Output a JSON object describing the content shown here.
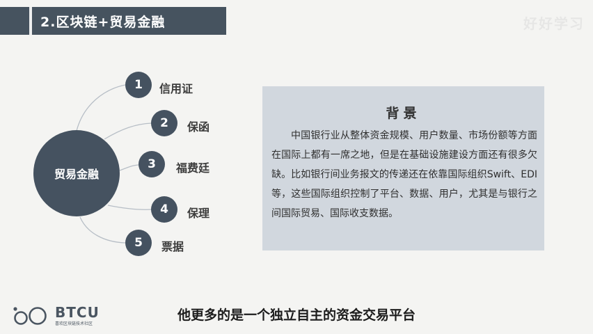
{
  "header": {
    "title": "2.区块链+贸易金融"
  },
  "watermark": {
    "text": "好好学习"
  },
  "diagram": {
    "center": {
      "label": "贸易金融"
    },
    "items": [
      {
        "number": "1",
        "label": "信用证"
      },
      {
        "number": "2",
        "label": "保函"
      },
      {
        "number": "3",
        "label": "福费廷"
      },
      {
        "number": "4",
        "label": "保理"
      },
      {
        "number": "5",
        "label": "票据"
      }
    ]
  },
  "panel": {
    "title": "背景",
    "body": "中国银行业从整体资金规模、用户数量、市场份额等方面在国际上都有一席之地，但是在基础设施建设方面还有很多欠缺。比如银行间业务报文的传递还在依靠国际组织Swift、EDI等，这些国际组织控制了平台、数据、用户，尤其是与银行之间国际贸易、国际收支数据。"
  },
  "logo": {
    "name": "BTCU",
    "tagline": "喜欢区块链技术社区"
  },
  "subtitle": "他更多的是一个独立自主的资金交易平台",
  "colors": {
    "header_bg": "#46535f",
    "node_bg": "#455260",
    "panel_bg": "#d1d7de",
    "line": "#b7bec6"
  }
}
